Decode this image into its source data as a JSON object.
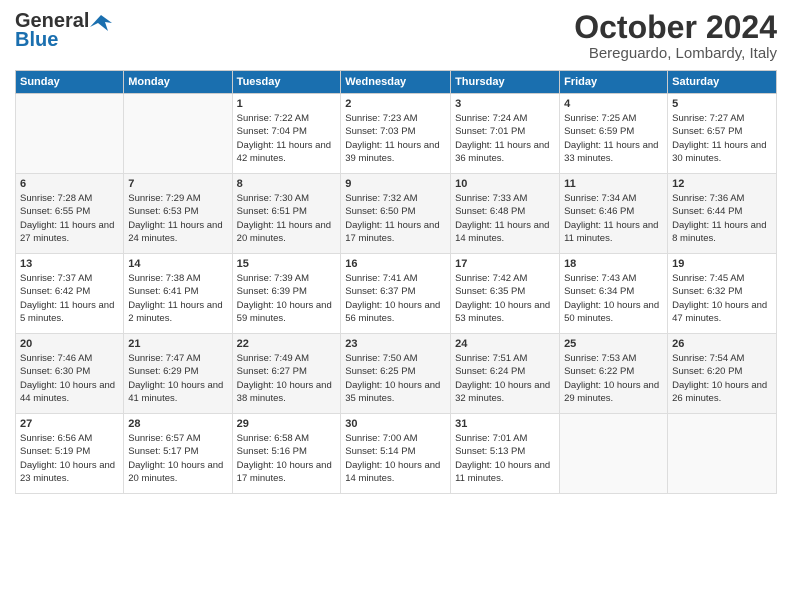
{
  "header": {
    "logo_general": "General",
    "logo_blue": "Blue",
    "month_title": "October 2024",
    "location": "Bereguardo, Lombardy, Italy"
  },
  "weekdays": [
    "Sunday",
    "Monday",
    "Tuesday",
    "Wednesday",
    "Thursday",
    "Friday",
    "Saturday"
  ],
  "weeks": [
    [
      {
        "day": "",
        "info": ""
      },
      {
        "day": "",
        "info": ""
      },
      {
        "day": "1",
        "info": "Sunrise: 7:22 AM\nSunset: 7:04 PM\nDaylight: 11 hours and 42 minutes."
      },
      {
        "day": "2",
        "info": "Sunrise: 7:23 AM\nSunset: 7:03 PM\nDaylight: 11 hours and 39 minutes."
      },
      {
        "day": "3",
        "info": "Sunrise: 7:24 AM\nSunset: 7:01 PM\nDaylight: 11 hours and 36 minutes."
      },
      {
        "day": "4",
        "info": "Sunrise: 7:25 AM\nSunset: 6:59 PM\nDaylight: 11 hours and 33 minutes."
      },
      {
        "day": "5",
        "info": "Sunrise: 7:27 AM\nSunset: 6:57 PM\nDaylight: 11 hours and 30 minutes."
      }
    ],
    [
      {
        "day": "6",
        "info": "Sunrise: 7:28 AM\nSunset: 6:55 PM\nDaylight: 11 hours and 27 minutes."
      },
      {
        "day": "7",
        "info": "Sunrise: 7:29 AM\nSunset: 6:53 PM\nDaylight: 11 hours and 24 minutes."
      },
      {
        "day": "8",
        "info": "Sunrise: 7:30 AM\nSunset: 6:51 PM\nDaylight: 11 hours and 20 minutes."
      },
      {
        "day": "9",
        "info": "Sunrise: 7:32 AM\nSunset: 6:50 PM\nDaylight: 11 hours and 17 minutes."
      },
      {
        "day": "10",
        "info": "Sunrise: 7:33 AM\nSunset: 6:48 PM\nDaylight: 11 hours and 14 minutes."
      },
      {
        "day": "11",
        "info": "Sunrise: 7:34 AM\nSunset: 6:46 PM\nDaylight: 11 hours and 11 minutes."
      },
      {
        "day": "12",
        "info": "Sunrise: 7:36 AM\nSunset: 6:44 PM\nDaylight: 11 hours and 8 minutes."
      }
    ],
    [
      {
        "day": "13",
        "info": "Sunrise: 7:37 AM\nSunset: 6:42 PM\nDaylight: 11 hours and 5 minutes."
      },
      {
        "day": "14",
        "info": "Sunrise: 7:38 AM\nSunset: 6:41 PM\nDaylight: 11 hours and 2 minutes."
      },
      {
        "day": "15",
        "info": "Sunrise: 7:39 AM\nSunset: 6:39 PM\nDaylight: 10 hours and 59 minutes."
      },
      {
        "day": "16",
        "info": "Sunrise: 7:41 AM\nSunset: 6:37 PM\nDaylight: 10 hours and 56 minutes."
      },
      {
        "day": "17",
        "info": "Sunrise: 7:42 AM\nSunset: 6:35 PM\nDaylight: 10 hours and 53 minutes."
      },
      {
        "day": "18",
        "info": "Sunrise: 7:43 AM\nSunset: 6:34 PM\nDaylight: 10 hours and 50 minutes."
      },
      {
        "day": "19",
        "info": "Sunrise: 7:45 AM\nSunset: 6:32 PM\nDaylight: 10 hours and 47 minutes."
      }
    ],
    [
      {
        "day": "20",
        "info": "Sunrise: 7:46 AM\nSunset: 6:30 PM\nDaylight: 10 hours and 44 minutes."
      },
      {
        "day": "21",
        "info": "Sunrise: 7:47 AM\nSunset: 6:29 PM\nDaylight: 10 hours and 41 minutes."
      },
      {
        "day": "22",
        "info": "Sunrise: 7:49 AM\nSunset: 6:27 PM\nDaylight: 10 hours and 38 minutes."
      },
      {
        "day": "23",
        "info": "Sunrise: 7:50 AM\nSunset: 6:25 PM\nDaylight: 10 hours and 35 minutes."
      },
      {
        "day": "24",
        "info": "Sunrise: 7:51 AM\nSunset: 6:24 PM\nDaylight: 10 hours and 32 minutes."
      },
      {
        "day": "25",
        "info": "Sunrise: 7:53 AM\nSunset: 6:22 PM\nDaylight: 10 hours and 29 minutes."
      },
      {
        "day": "26",
        "info": "Sunrise: 7:54 AM\nSunset: 6:20 PM\nDaylight: 10 hours and 26 minutes."
      }
    ],
    [
      {
        "day": "27",
        "info": "Sunrise: 6:56 AM\nSunset: 5:19 PM\nDaylight: 10 hours and 23 minutes."
      },
      {
        "day": "28",
        "info": "Sunrise: 6:57 AM\nSunset: 5:17 PM\nDaylight: 10 hours and 20 minutes."
      },
      {
        "day": "29",
        "info": "Sunrise: 6:58 AM\nSunset: 5:16 PM\nDaylight: 10 hours and 17 minutes."
      },
      {
        "day": "30",
        "info": "Sunrise: 7:00 AM\nSunset: 5:14 PM\nDaylight: 10 hours and 14 minutes."
      },
      {
        "day": "31",
        "info": "Sunrise: 7:01 AM\nSunset: 5:13 PM\nDaylight: 10 hours and 11 minutes."
      },
      {
        "day": "",
        "info": ""
      },
      {
        "day": "",
        "info": ""
      }
    ]
  ]
}
